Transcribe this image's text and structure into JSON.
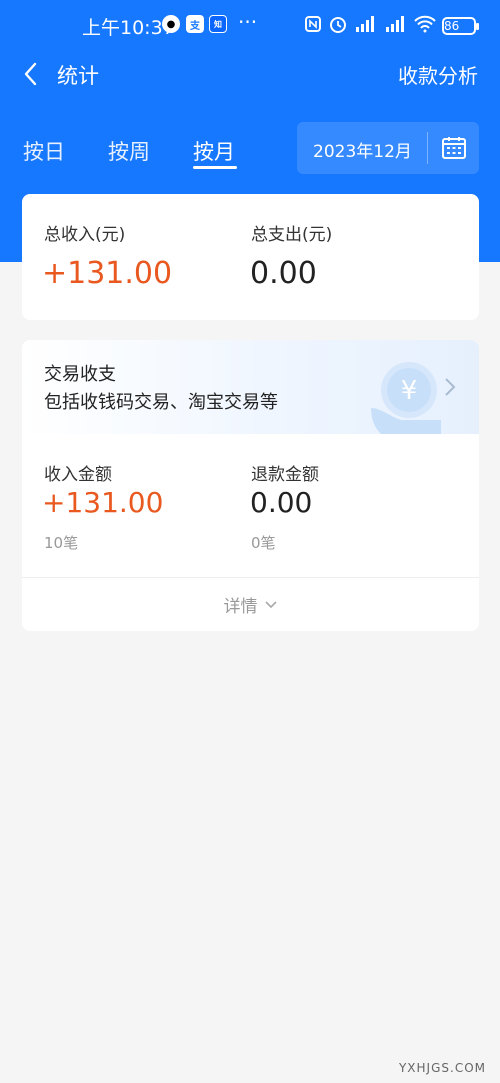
{
  "status_bar": {
    "time": "上午10:37",
    "battery": "86"
  },
  "nav": {
    "title": "统计",
    "right_action": "收款分析"
  },
  "tabs": {
    "day": "按日",
    "week": "按周",
    "month": "按月",
    "date": "2023年12月"
  },
  "summary": {
    "income_label": "总收入(元)",
    "income_value": "+131.00",
    "expense_label": "总支出(元)",
    "expense_value": "0.00"
  },
  "trade": {
    "title": "交易收支",
    "subtitle": "包括收钱码交易、淘宝交易等",
    "income_label": "收入金额",
    "income_value": "+131.00",
    "income_count": "10笔",
    "refund_label": "退款金额",
    "refund_value": "0.00",
    "refund_count": "0笔",
    "detail_label": "详情"
  },
  "watermark": "YXHJGS.COM",
  "colors": {
    "primary": "#1677ff",
    "income": "#e8581f",
    "background": "#f5f5f5"
  }
}
